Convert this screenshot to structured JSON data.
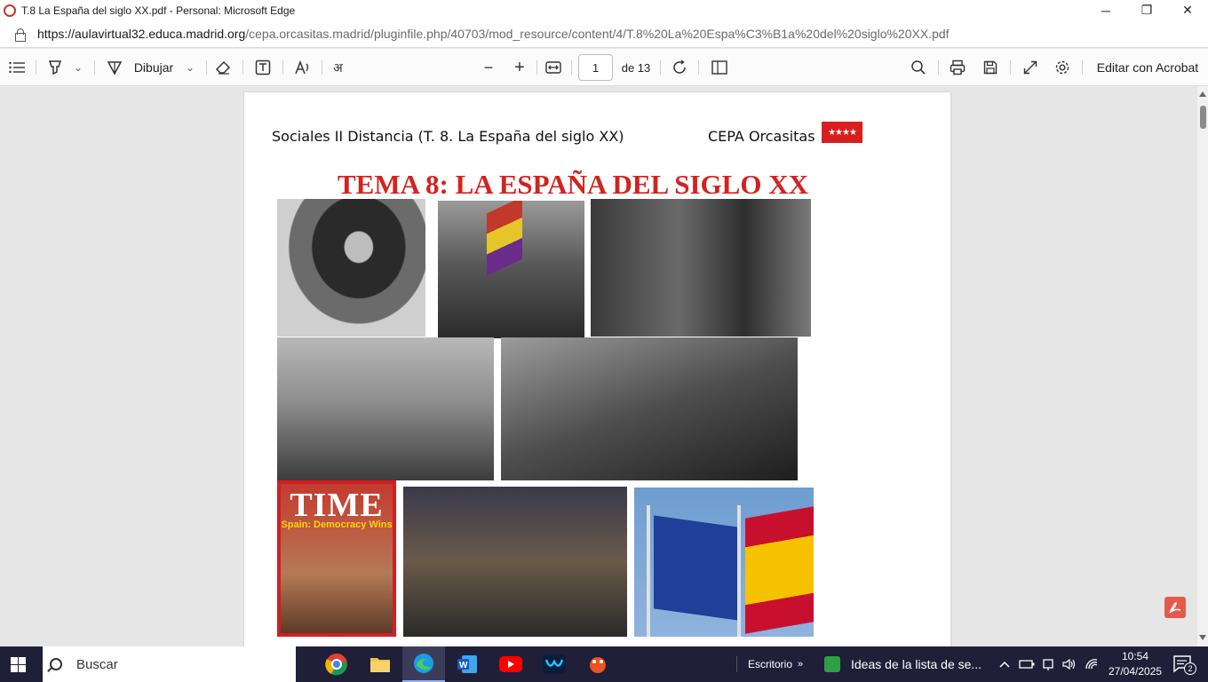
{
  "window": {
    "title": "T.8 La España del siglo XX.pdf - Personal: Microsoft Edge",
    "minimize": "─",
    "restore": "❐",
    "close": "✕"
  },
  "address": {
    "url_host": "https://aulavirtual32.educa.madrid.org",
    "url_path": "/cepa.orcasitas.madrid/pluginfile.php/40703/mod_resource/content/4/T.8%20La%20Espa%C3%B1a%20del%20siglo%20XX.pdf"
  },
  "toolbar": {
    "draw_label": "Dibujar",
    "page_current": "1",
    "page_total_label": "de 13",
    "edit_acrobat_label": "Editar con Acrobat",
    "zoom_out": "−",
    "zoom_in": "+",
    "chevron": "⌄"
  },
  "document": {
    "header_left": "Sociales II Distancia (T. 8. La España del siglo XX)",
    "header_right": "CEPA Orcasitas",
    "flag_stars": "★★★★",
    "title": "TEMA 8:  LA ESPAÑA DEL SIGLO XX",
    "time_cover": {
      "masthead": "TIME",
      "headline": "Spain: Democracy Wins"
    }
  },
  "taskbar": {
    "search_placeholder": "Buscar",
    "desktop_label": "Escritorio",
    "widget_label": "Ideas de la lista de se...",
    "time": "10:54",
    "date": "27/04/2025",
    "notifications": "2"
  },
  "colors": {
    "title_red": "#d2231f",
    "taskbar_bg": "#1f1f3a",
    "madrid_red": "#d81e1e"
  }
}
